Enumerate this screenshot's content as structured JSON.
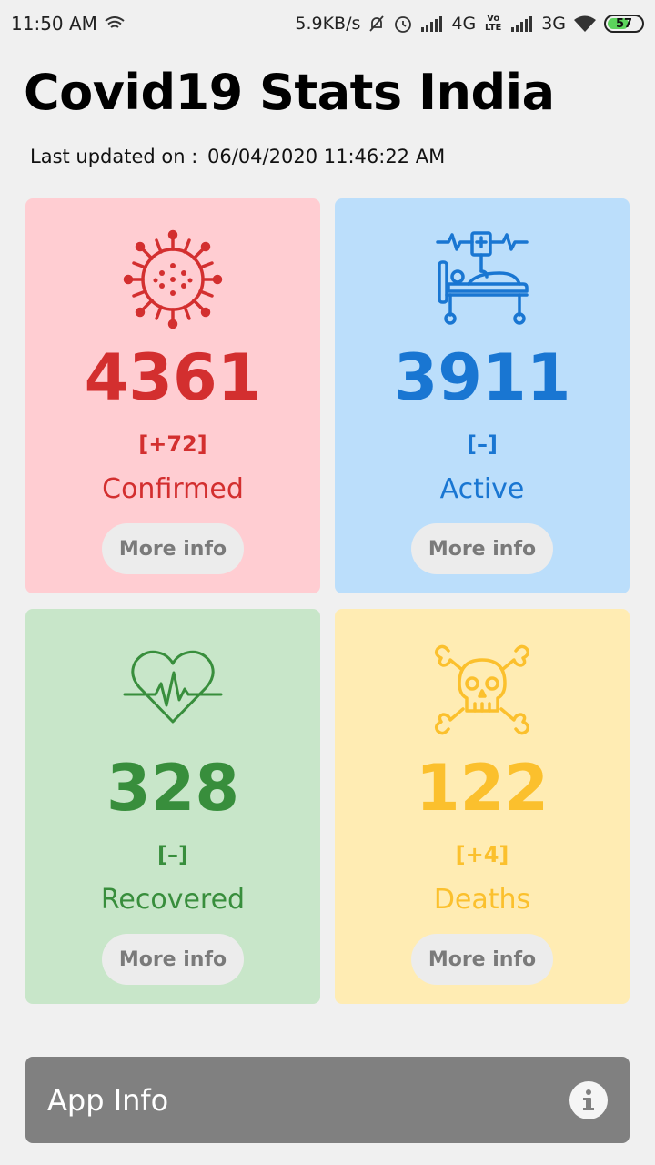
{
  "status_bar": {
    "time": "11:50 AM",
    "net_speed": "5.9KB/s",
    "net1": "4G",
    "volte": "Vo LTE",
    "net2": "3G",
    "battery": "57"
  },
  "app": {
    "title": "Covid19 Stats India",
    "updated_label": "Last updated on :",
    "updated_value": "06/04/2020 11:46:22 AM"
  },
  "cards": {
    "confirmed": {
      "count": "4361",
      "delta": "[+72]",
      "label": "Confirmed",
      "more": "More info",
      "color": "#d32f2f",
      "icon": "virus-icon"
    },
    "active": {
      "count": "3911",
      "delta": "[–]",
      "label": "Active",
      "more": "More info",
      "color": "#1976d2",
      "icon": "hospital-bed-icon"
    },
    "recovered": {
      "count": "328",
      "delta": "[–]",
      "label": "Recovered",
      "more": "More info",
      "color": "#388e3c",
      "icon": "heartbeat-icon"
    },
    "deaths": {
      "count": "122",
      "delta": "[+4]",
      "label": "Deaths",
      "more": "More info",
      "color": "#fbc02d",
      "icon": "skull-crossbones-icon"
    }
  },
  "footer": {
    "app_info_label": "App Info"
  }
}
